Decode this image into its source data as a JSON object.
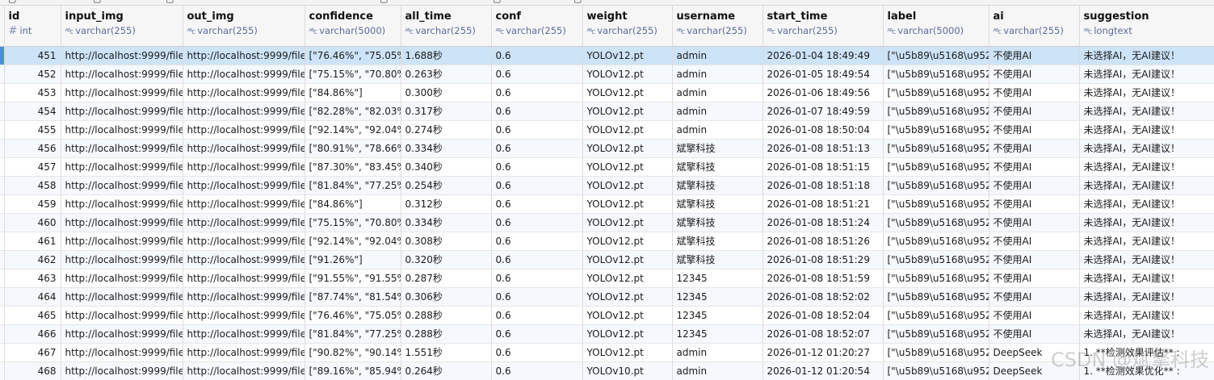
{
  "columns": [
    {
      "name": "id",
      "type": "int",
      "type_icon": "#"
    },
    {
      "name": "input_img",
      "type": "varchar(255)",
      "type_icon": "ABC"
    },
    {
      "name": "out_img",
      "type": "varchar(255)",
      "type_icon": "ABC"
    },
    {
      "name": "confidence",
      "type": "varchar(5000)",
      "type_icon": "ABC"
    },
    {
      "name": "all_time",
      "type": "varchar(255)",
      "type_icon": "ABC"
    },
    {
      "name": "conf",
      "type": "varchar(255)",
      "type_icon": "ABC"
    },
    {
      "name": "weight",
      "type": "varchar(255)",
      "type_icon": "ABC"
    },
    {
      "name": "username",
      "type": "varchar(255)",
      "type_icon": "ABC"
    },
    {
      "name": "start_time",
      "type": "varchar(255)",
      "type_icon": "ABC"
    },
    {
      "name": "label",
      "type": "varchar(5000)",
      "type_icon": "ABC"
    },
    {
      "name": "ai",
      "type": "varchar(255)",
      "type_icon": "ABC"
    },
    {
      "name": "suggestion",
      "type": "longtext",
      "type_icon": "ABC"
    }
  ],
  "rows": [
    [
      "451",
      "http://localhost:9999/file",
      "http://localhost:9999/file",
      "[\"76.46%\", \"75.05%",
      "1.688秒",
      "0.6",
      "YOLOv12.pt",
      "admin",
      "2026-01-04 18:49:49",
      "[\"\\u5b89\\u5168\\u952",
      "不使用AI",
      "未选择AI，无AI建议！"
    ],
    [
      "452",
      "http://localhost:9999/file",
      "http://localhost:9999/file",
      "[\"75.15%\", \"70.80%",
      "0.263秒",
      "0.6",
      "YOLOv12.pt",
      "admin",
      "2026-01-05 18:49:54",
      "[\"\\u5b89\\u5168\\u952",
      "不使用AI",
      "未选择AI，无AI建议！"
    ],
    [
      "453",
      "http://localhost:9999/file",
      "http://localhost:9999/file",
      "[\"84.86%\"]",
      "0.300秒",
      "0.6",
      "YOLOv12.pt",
      "admin",
      "2026-01-06 18:49:56",
      "[\"\\u5b89\\u5168\\u952",
      "不使用AI",
      "未选择AI，无AI建议！"
    ],
    [
      "454",
      "http://localhost:9999/file",
      "http://localhost:9999/file",
      "[\"82.28%\", \"82.03%",
      "0.317秒",
      "0.6",
      "YOLOv12.pt",
      "admin",
      "2026-01-07 18:49:59",
      "[\"\\u5b89\\u5168\\u952",
      "不使用AI",
      "未选择AI，无AI建议！"
    ],
    [
      "455",
      "http://localhost:9999/file",
      "http://localhost:9999/file",
      "[\"92.14%\", \"92.04%",
      "0.274秒",
      "0.6",
      "YOLOv12.pt",
      "admin",
      "2026-01-08 18:50:04",
      "[\"\\u5b89\\u5168\\u952",
      "不使用AI",
      "未选择AI，无AI建议！"
    ],
    [
      "456",
      "http://localhost:9999/file",
      "http://localhost:9999/file",
      "[\"80.91%\", \"78.66%",
      "0.334秒",
      "0.6",
      "YOLOv12.pt",
      "斌擎科技",
      "2026-01-08 18:51:13",
      "[\"\\u5b89\\u5168\\u952",
      "不使用AI",
      "未选择AI，无AI建议！"
    ],
    [
      "457",
      "http://localhost:9999/file",
      "http://localhost:9999/file",
      "[\"87.30%\", \"83.45%",
      "0.340秒",
      "0.6",
      "YOLOv12.pt",
      "斌擎科技",
      "2026-01-08 18:51:15",
      "[\"\\u5b89\\u5168\\u952",
      "不使用AI",
      "未选择AI，无AI建议！"
    ],
    [
      "458",
      "http://localhost:9999/file",
      "http://localhost:9999/file",
      "[\"81.84%\", \"77.25%",
      "0.254秒",
      "0.6",
      "YOLOv12.pt",
      "斌擎科技",
      "2026-01-08 18:51:18",
      "[\"\\u5b89\\u5168\\u952",
      "不使用AI",
      "未选择AI，无AI建议！"
    ],
    [
      "459",
      "http://localhost:9999/file",
      "http://localhost:9999/file",
      "[\"84.86%\"]",
      "0.312秒",
      "0.6",
      "YOLOv12.pt",
      "斌擎科技",
      "2026-01-08 18:51:21",
      "[\"\\u5b89\\u5168\\u952",
      "不使用AI",
      "未选择AI，无AI建议！"
    ],
    [
      "460",
      "http://localhost:9999/file",
      "http://localhost:9999/file",
      "[\"75.15%\", \"70.80%",
      "0.334秒",
      "0.6",
      "YOLOv12.pt",
      "斌擎科技",
      "2026-01-08 18:51:24",
      "[\"\\u5b89\\u5168\\u952",
      "不使用AI",
      "未选择AI，无AI建议！"
    ],
    [
      "461",
      "http://localhost:9999/file",
      "http://localhost:9999/file",
      "[\"92.14%\", \"92.04%",
      "0.308秒",
      "0.6",
      "YOLOv12.pt",
      "斌擎科技",
      "2026-01-08 18:51:26",
      "[\"\\u5b89\\u5168\\u952",
      "不使用AI",
      "未选择AI，无AI建议！"
    ],
    [
      "462",
      "http://localhost:9999/file",
      "http://localhost:9999/file",
      "[\"91.26%\"]",
      "0.320秒",
      "0.6",
      "YOLOv12.pt",
      "斌擎科技",
      "2026-01-08 18:51:29",
      "[\"\\u5b89\\u5168\\u952",
      "不使用AI",
      "未选择AI，无AI建议！"
    ],
    [
      "463",
      "http://localhost:9999/file",
      "http://localhost:9999/file",
      "[\"91.55%\", \"91.55%",
      "0.287秒",
      "0.6",
      "YOLOv12.pt",
      "12345",
      "2026-01-08 18:51:59",
      "[\"\\u5b89\\u5168\\u952",
      "不使用AI",
      "未选择AI，无AI建议！"
    ],
    [
      "464",
      "http://localhost:9999/file",
      "http://localhost:9999/file",
      "[\"87.74%\", \"81.54%",
      "0.306秒",
      "0.6",
      "YOLOv12.pt",
      "12345",
      "2026-01-08 18:52:02",
      "[\"\\u5b89\\u5168\\u952",
      "不使用AI",
      "未选择AI，无AI建议！"
    ],
    [
      "465",
      "http://localhost:9999/file",
      "http://localhost:9999/file",
      "[\"76.46%\", \"75.05%",
      "0.288秒",
      "0.6",
      "YOLOv12.pt",
      "12345",
      "2026-01-08 18:52:04",
      "[\"\\u5b89\\u5168\\u952",
      "不使用AI",
      "未选择AI，无AI建议！"
    ],
    [
      "466",
      "http://localhost:9999/file",
      "http://localhost:9999/file",
      "[\"81.84%\", \"77.25%",
      "0.288秒",
      "0.6",
      "YOLOv12.pt",
      "12345",
      "2026-01-08 18:52:07",
      "[\"\\u5b89\\u5168\\u952",
      "不使用AI",
      "未选择AI，无AI建议！"
    ],
    [
      "467",
      "http://localhost:9999/file",
      "http://localhost:9999/file",
      "[\"90.82%\", \"90.14%",
      "1.551秒",
      "0.6",
      "YOLOv12.pt",
      "admin",
      "2026-01-12 01:20:27",
      "[\"\\u5b89\\u5168\\u952",
      "DeepSeek",
      "1. **检测效果评估** :"
    ],
    [
      "468",
      "http://localhost:9999/file",
      "http://localhost:9999/file",
      "[\"89.16%\", \"85.94%",
      "0.264秒",
      "0.6",
      "YOLOv10.pt",
      "admin",
      "2026-01-12 01:20:54",
      "[\"\\u5b89\\u5168\\u952",
      "DeepSeek",
      "1. **检测效果优化** :"
    ]
  ],
  "selected_row_index": 0,
  "watermark": "CSDN @斌擎科技",
  "colors": {
    "selected_row": "#cde3f7",
    "header_bg": "#f6f6f6",
    "type_text": "#5b6b9a"
  }
}
